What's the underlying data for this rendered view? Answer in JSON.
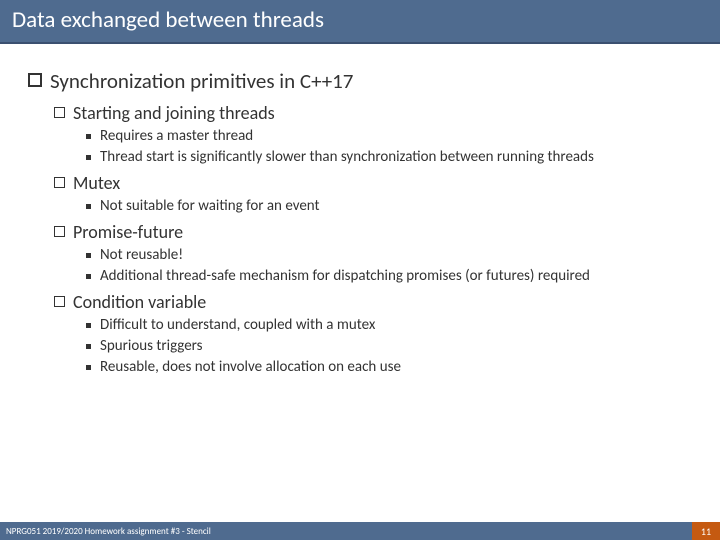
{
  "title": "Data exchanged between threads",
  "heading": "Synchronization primitives in C++17",
  "sections": [
    {
      "label": "Starting and joining threads",
      "bullets": [
        "Requires a master thread",
        "Thread start is significantly slower than synchronization between running threads"
      ]
    },
    {
      "label": "Mutex",
      "bullets": [
        "Not suitable for waiting for an event"
      ]
    },
    {
      "label": "Promise-future",
      "bullets": [
        "Not reusable!",
        "Additional thread-safe mechanism for dispatching promises (or futures) required"
      ]
    },
    {
      "label": "Condition variable",
      "bullets": [
        "Difficult to understand, coupled with a mutex",
        "Spurious triggers",
        "Reusable, does not involve allocation on each use"
      ]
    }
  ],
  "footer_left": "NPRG051 2019/2020 Homework assignment #3 - Stencil",
  "page_number": "11"
}
